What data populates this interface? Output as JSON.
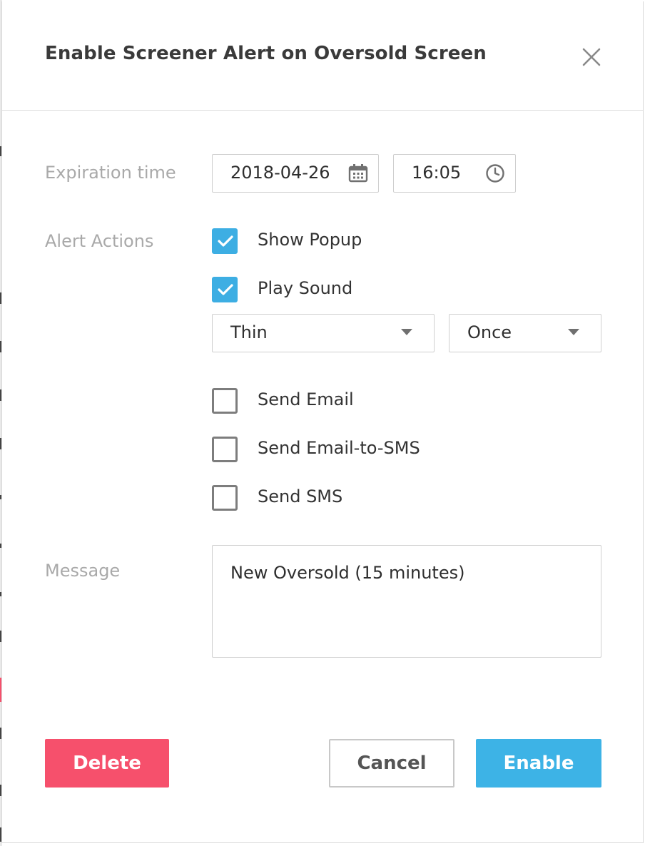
{
  "dialog": {
    "title": "Enable Screener Alert on Oversold Screen",
    "close_icon": "close-icon"
  },
  "expiration": {
    "label": "Expiration time",
    "date": "2018-04-26",
    "date_icon": "calendar-icon",
    "time": "16:05",
    "time_icon": "clock-icon"
  },
  "alert_actions": {
    "label": "Alert Actions",
    "options": [
      {
        "label": "Show Popup",
        "checked": true
      },
      {
        "label": "Play Sound",
        "checked": true
      },
      {
        "label": "Send Email",
        "checked": false
      },
      {
        "label": "Send Email-to-SMS",
        "checked": false
      },
      {
        "label": "Send SMS",
        "checked": false
      }
    ],
    "sound_select": {
      "value": "Thin"
    },
    "repeat_select": {
      "value": "Once"
    }
  },
  "message": {
    "label": "Message",
    "value": "New Oversold (15 minutes)"
  },
  "buttons": {
    "delete": "Delete",
    "cancel": "Cancel",
    "enable": "Enable"
  },
  "colors": {
    "accent": "#3db3e6",
    "danger": "#f6506c",
    "label": "#a9a9a9",
    "text": "#333333"
  }
}
